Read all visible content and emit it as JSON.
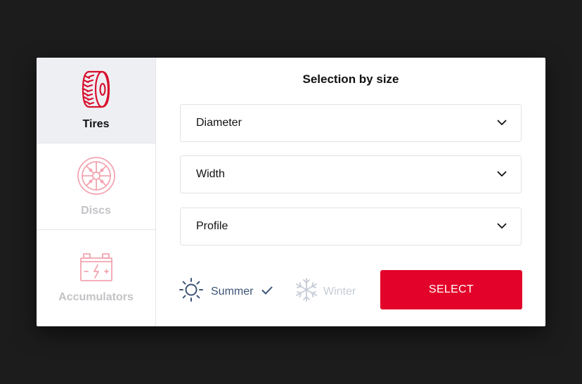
{
  "sidebar": {
    "items": [
      {
        "label": "Tires",
        "icon": "tire-icon",
        "active": true
      },
      {
        "label": "Discs",
        "icon": "wheel-disc-icon",
        "active": false
      },
      {
        "label": "Accumulators",
        "icon": "battery-icon",
        "active": false
      }
    ]
  },
  "main": {
    "title": "Selection by size",
    "selects": [
      {
        "placeholder": "Diameter"
      },
      {
        "placeholder": "Width"
      },
      {
        "placeholder": "Profile"
      }
    ],
    "seasons": [
      {
        "label": "Summer",
        "icon": "sun-icon",
        "selected": true
      },
      {
        "label": "Winter",
        "icon": "snowflake-icon",
        "selected": false
      }
    ],
    "select_button": "SELECT"
  },
  "colors": {
    "accent": "#e3032a",
    "summer": "#3d5478",
    "inactive": "#c6ccd6",
    "sidebar_active_bg": "#eeeff3"
  }
}
